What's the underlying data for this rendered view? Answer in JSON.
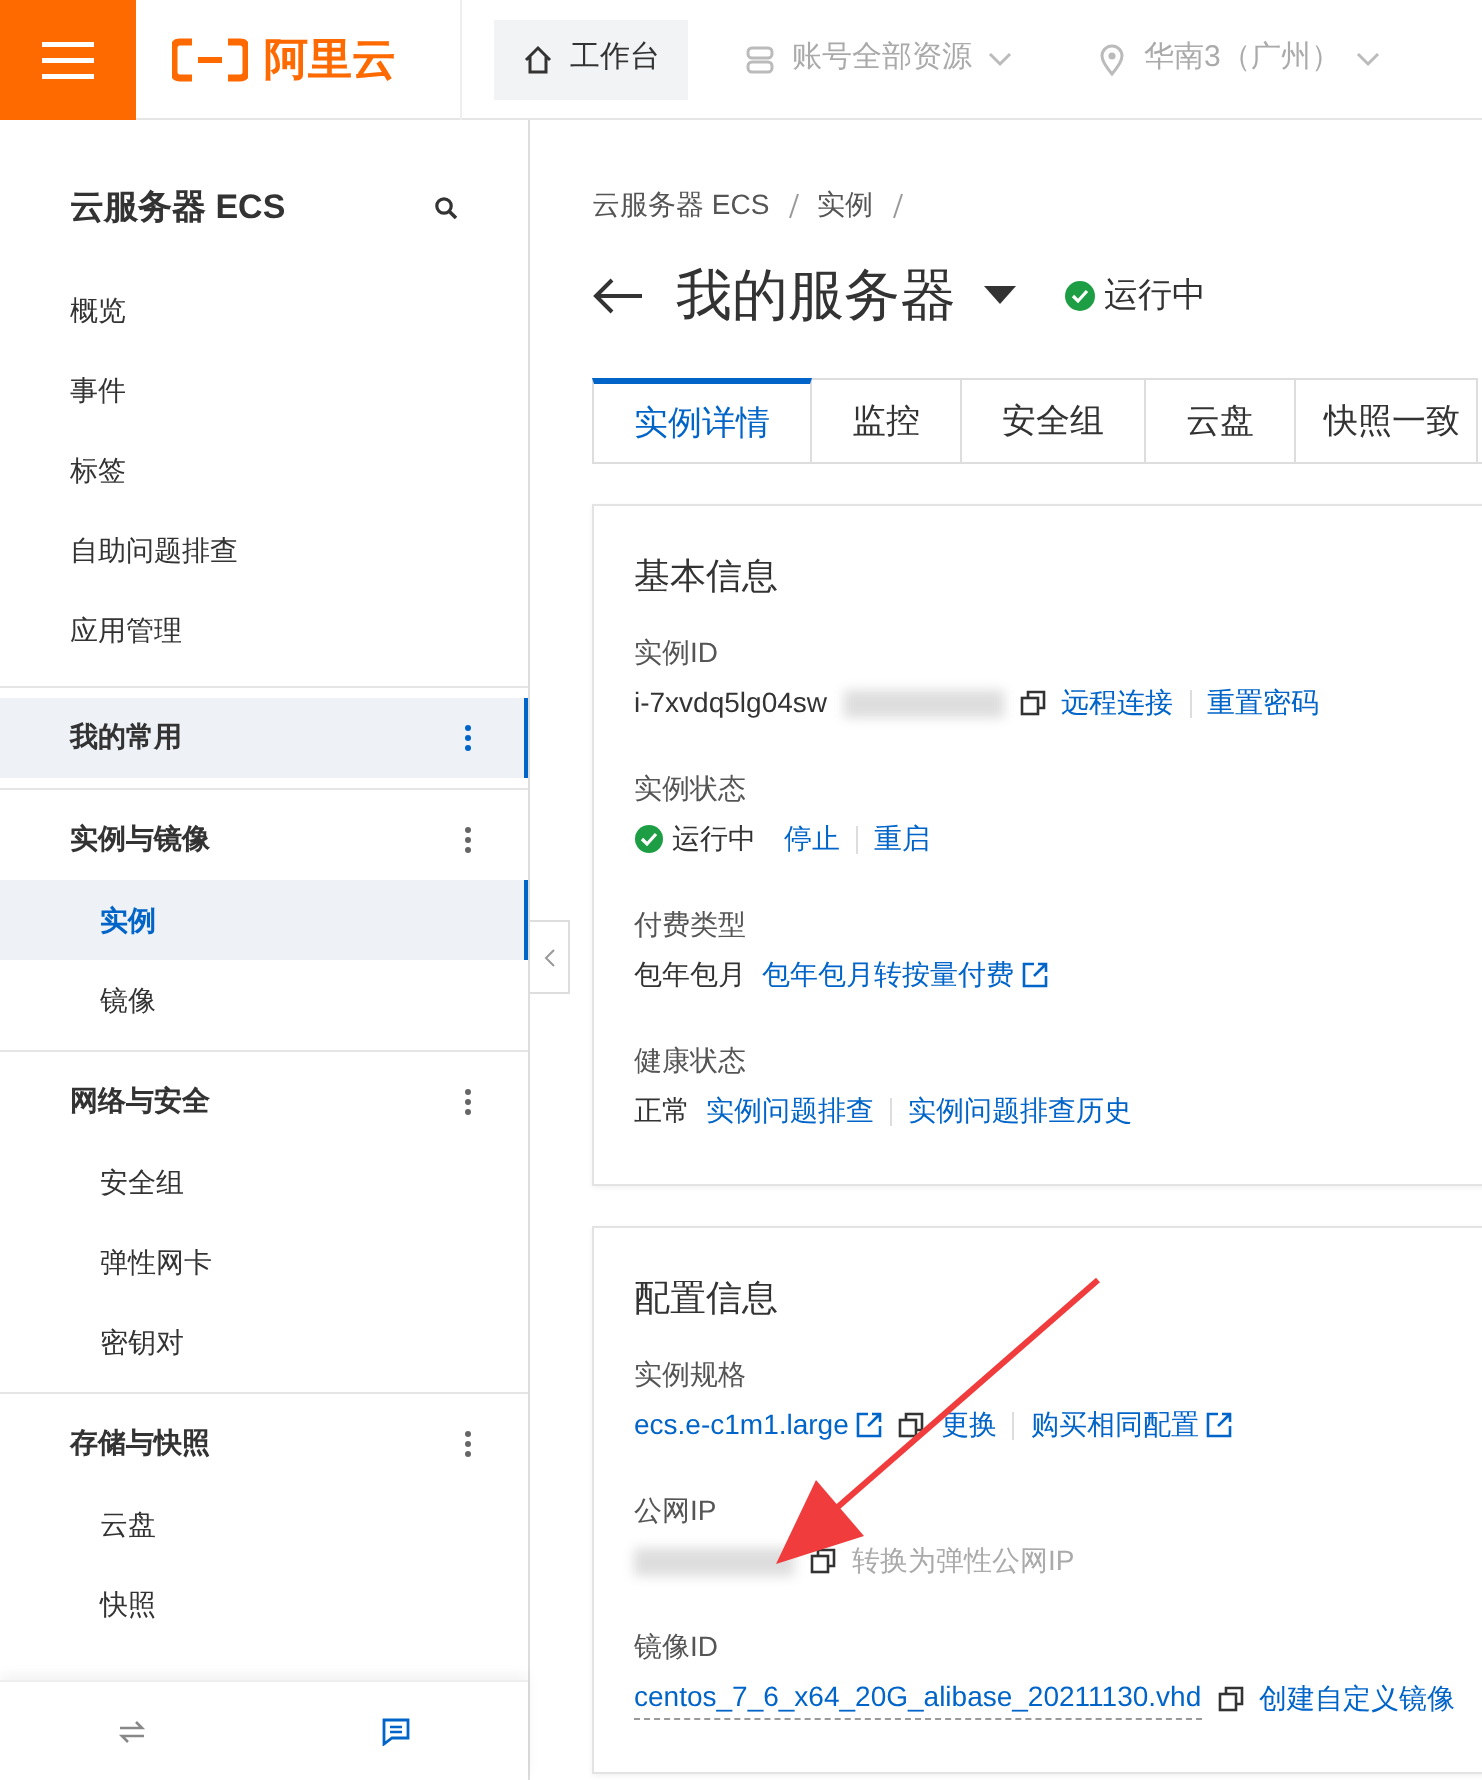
{
  "topbar": {
    "logo": "阿里云",
    "nav": [
      {
        "label": "工作台",
        "kind": "home",
        "selected": true
      },
      {
        "label": "账号全部资源",
        "kind": "resources",
        "selected": false
      },
      {
        "label": "华南3（广州）",
        "kind": "region",
        "selected": false
      }
    ]
  },
  "sidebar": {
    "title": "云服务器 ECS",
    "items": [
      {
        "label": "概览"
      },
      {
        "label": "事件"
      },
      {
        "label": "标签"
      },
      {
        "label": "自助问题排查"
      },
      {
        "label": "应用管理"
      }
    ],
    "groups": [
      {
        "title": "我的常用",
        "selected": true
      },
      {
        "title": "实例与镜像",
        "selected": false,
        "items": [
          {
            "label": "实例",
            "selected": true
          },
          {
            "label": "镜像",
            "selected": false
          }
        ]
      },
      {
        "title": "网络与安全",
        "selected": false,
        "items": [
          {
            "label": "安全组",
            "selected": false
          },
          {
            "label": "弹性网卡",
            "selected": false
          },
          {
            "label": "密钥对",
            "selected": false
          }
        ]
      },
      {
        "title": "存储与快照",
        "selected": false,
        "items": [
          {
            "label": "云盘",
            "selected": false
          },
          {
            "label": "快照",
            "selected": false
          }
        ]
      }
    ]
  },
  "breadcrumb": [
    "云服务器 ECS",
    "实例"
  ],
  "title": "我的服务器",
  "status": "运行中",
  "tabs": [
    {
      "label": "实例详情",
      "selected": true
    },
    {
      "label": "监控",
      "selected": false
    },
    {
      "label": "安全组",
      "selected": false
    },
    {
      "label": "云盘",
      "selected": false
    },
    {
      "label": "快照一致",
      "selected": false
    }
  ],
  "cards": [
    {
      "title": "基本信息",
      "fields": [
        {
          "label": "实例ID",
          "parts": [
            {
              "kind": "text",
              "text": "i-7xvdq5lg04sw"
            },
            {
              "kind": "redacted"
            },
            {
              "kind": "copy"
            },
            {
              "kind": "link",
              "text": "远程连接"
            },
            {
              "kind": "sep"
            },
            {
              "kind": "link",
              "text": "重置密码"
            }
          ]
        },
        {
          "label": "实例状态",
          "parts": [
            {
              "kind": "status",
              "text": "运行中"
            },
            {
              "kind": "link",
              "text": "停止"
            },
            {
              "kind": "sep"
            },
            {
              "kind": "link",
              "text": "重启"
            }
          ]
        },
        {
          "label": "付费类型",
          "parts": [
            {
              "kind": "text",
              "text": "包年包月"
            },
            {
              "kind": "link",
              "text": "包年包月转按量付费",
              "external": true
            }
          ]
        },
        {
          "label": "健康状态",
          "parts": [
            {
              "kind": "text",
              "text": "正常"
            },
            {
              "kind": "link",
              "text": "实例问题排查"
            },
            {
              "kind": "sep"
            },
            {
              "kind": "link",
              "text": "实例问题排查历史"
            }
          ]
        }
      ]
    },
    {
      "title": "配置信息",
      "fields": [
        {
          "label": "实例规格",
          "parts": [
            {
              "kind": "link",
              "text": "ecs.e-c1m1.large",
              "external": true
            },
            {
              "kind": "copy"
            },
            {
              "kind": "link",
              "text": "更换"
            },
            {
              "kind": "sep"
            },
            {
              "kind": "link",
              "text": "购买相同配置",
              "external": true
            }
          ]
        },
        {
          "label": "公网IP",
          "parts": [
            {
              "kind": "redacted"
            },
            {
              "kind": "copy"
            },
            {
              "kind": "link",
              "text": "转换为弹性公网IP",
              "disabled": true
            }
          ]
        },
        {
          "label": "镜像ID",
          "parts": [
            {
              "kind": "id_link",
              "text": "centos_7_6_x64_20G_alibase_20211130.vhd"
            },
            {
              "kind": "copy"
            },
            {
              "kind": "link",
              "text": "创建自定义镜像"
            }
          ]
        }
      ]
    }
  ],
  "annotation": {
    "kind": "arrow"
  }
}
